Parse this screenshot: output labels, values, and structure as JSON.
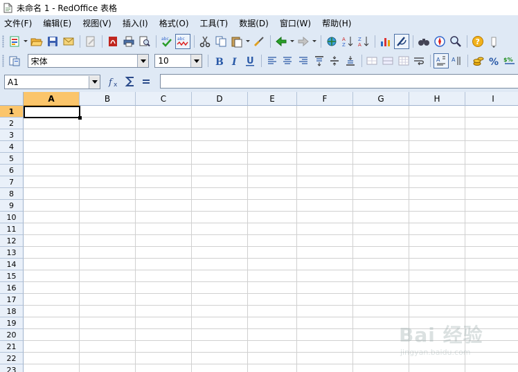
{
  "window": {
    "title": "未命名 1 - RedOffice 表格"
  },
  "menu": [
    "文件(F)",
    "编辑(E)",
    "视图(V)",
    "插入(I)",
    "格式(O)",
    "工具(T)",
    "数据(D)",
    "窗口(W)",
    "帮助(H)"
  ],
  "format_toolbar": {
    "font_name": "宋体",
    "font_size": "10"
  },
  "formula_bar": {
    "cell_ref": "A1",
    "content": ""
  },
  "sheet": {
    "columns": [
      "A",
      "B",
      "C",
      "D",
      "E",
      "F",
      "G",
      "H",
      "I"
    ],
    "rows": [
      "1",
      "2",
      "3",
      "4",
      "5",
      "6",
      "7",
      "8",
      "9",
      "10",
      "11",
      "12",
      "13",
      "14",
      "15",
      "16",
      "17",
      "18",
      "19",
      "20",
      "21",
      "22",
      "23"
    ],
    "active_column": "A",
    "active_row": "1"
  },
  "watermark": {
    "main": "Bai 经验",
    "sub": "jingyan.baidu.com"
  },
  "colors": {
    "toolbar_bg": "#dfe9f5",
    "header_active": "#fbc56b",
    "header_bg": "#e9f0f9"
  }
}
